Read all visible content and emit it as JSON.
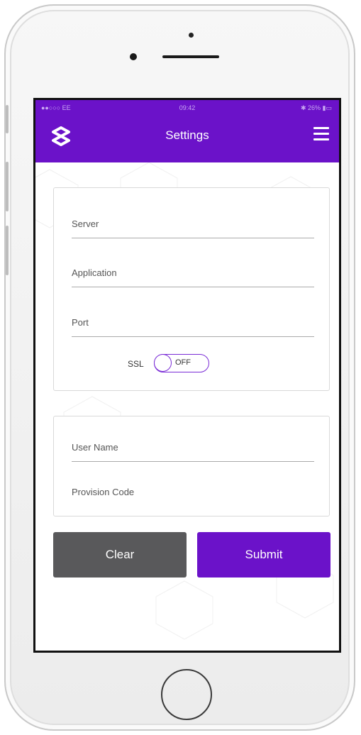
{
  "colors": {
    "brand": "#6b12c9",
    "clear_button": "#59595b",
    "toggle_border": "#7a2bd6"
  },
  "status_bar": {
    "carrier": "●●○○○ EE",
    "time": "09:42",
    "battery": "✱ 26% ▮▭"
  },
  "header": {
    "title": "Settings",
    "logo_icon": "app-logo-icon",
    "menu_icon": "hamburger-menu-icon"
  },
  "server_form": {
    "server_placeholder": "Server",
    "application_placeholder": "Application",
    "port_placeholder": "Port",
    "ssl_label": "SSL",
    "ssl_toggle_state": "OFF"
  },
  "user_form": {
    "username_placeholder": "User Name",
    "provision_placeholder": "Provision Code"
  },
  "actions": {
    "clear_label": "Clear",
    "submit_label": "Submit"
  }
}
